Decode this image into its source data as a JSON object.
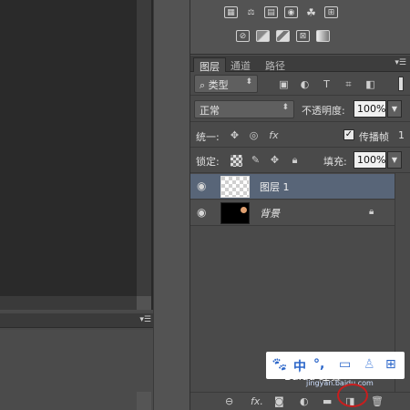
{
  "lower_panel": {
    "menu_icon": "panel-menu-icon"
  },
  "tabs": [
    {
      "label": "图层",
      "active": true
    },
    {
      "label": "通道",
      "active": false
    },
    {
      "label": "路径",
      "active": false
    }
  ],
  "filter": {
    "kind_label": "类型",
    "kind_icon": "search-icon"
  },
  "blend": {
    "mode": "正常",
    "opacity_label": "不透明度:",
    "opacity_value": "100%"
  },
  "unify": {
    "label": "统一:",
    "propagate_label": "传播帧",
    "propagate_checked": true,
    "frame_number": "1"
  },
  "lock": {
    "label": "锁定:",
    "fill_label": "填充:",
    "fill_value": "100%"
  },
  "layers": [
    {
      "name": "图层 1",
      "selected": true,
      "visible": true,
      "type": "transparent"
    },
    {
      "name": "背景",
      "selected": false,
      "visible": true,
      "type": "background",
      "locked": true
    }
  ],
  "watermark": {
    "text": "Baidu 经验",
    "sub": "jingyan.baidu.com"
  },
  "colors": {
    "selected_layer": "#586578",
    "accent_red": "#c81e1e"
  }
}
